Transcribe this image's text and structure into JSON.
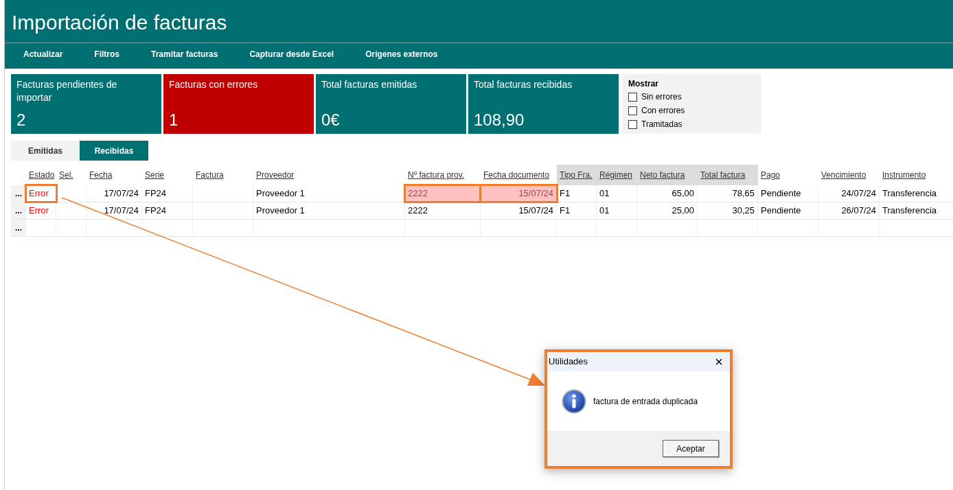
{
  "window": {
    "title": "Importación de facturas"
  },
  "menu": [
    "Actualizar",
    "Filtros",
    "Tramitar facturas",
    "Capturar desde Excel",
    "Orígenes externos"
  ],
  "stats": [
    {
      "label": "Facturas pendientes de importar",
      "value": "2",
      "kind": "normal"
    },
    {
      "label": "Facturas con errores",
      "value": "1",
      "kind": "alert"
    },
    {
      "label": "Total facturas emitidas",
      "value": "0€",
      "kind": "normal"
    },
    {
      "label": "Total facturas recibidas",
      "value": "108,90",
      "kind": "normal"
    }
  ],
  "filters": {
    "title": "Mostrar",
    "options": [
      {
        "label": "Sin errores",
        "checked": false
      },
      {
        "label": "Con errores",
        "checked": false
      },
      {
        "label": "Tramitadas",
        "checked": false
      }
    ]
  },
  "tabs": [
    {
      "label": "Emitidas",
      "selected": false
    },
    {
      "label": "Recibidas",
      "selected": true
    }
  ],
  "table": {
    "columns": [
      {
        "label": "Estado",
        "shaded": false
      },
      {
        "label": "Sel.",
        "shaded": false
      },
      {
        "label": "Fecha",
        "shaded": false
      },
      {
        "label": "Serie",
        "shaded": false
      },
      {
        "label": "Factura",
        "shaded": false
      },
      {
        "label": "Proveedor",
        "shaded": false
      },
      {
        "label": "Nº factura prov.",
        "shaded": false
      },
      {
        "label": "Fecha documento",
        "shaded": false
      },
      {
        "label": "Tipo Fra.",
        "shaded": true
      },
      {
        "label": "Régimen",
        "shaded": true
      },
      {
        "label": "Neto factura",
        "shaded": true
      },
      {
        "label": "Total factura",
        "shaded": true
      },
      {
        "label": "Pago",
        "shaded": false
      },
      {
        "label": "Vencimiento",
        "shaded": false
      },
      {
        "label": "Instrumento",
        "shaded": false
      }
    ],
    "rows": [
      {
        "handle": "...",
        "cells": [
          {
            "text": "Error",
            "error": true,
            "marked": true,
            "highlighted": false
          },
          {
            "text": "",
            "marked": false,
            "highlighted": false
          },
          {
            "text": "17/07/24",
            "marked": false,
            "highlighted": false
          },
          {
            "text": "FP24",
            "marked": false,
            "highlighted": false
          },
          {
            "text": "",
            "marked": false,
            "highlighted": false
          },
          {
            "text": "Proveedor 1",
            "marked": false,
            "highlighted": false
          },
          {
            "text": "2222",
            "marked": true,
            "highlighted": true
          },
          {
            "text": "15/07/24",
            "marked": true,
            "highlighted": true
          },
          {
            "text": "F1",
            "marked": false,
            "highlighted": false
          },
          {
            "text": "01",
            "marked": false,
            "highlighted": false
          },
          {
            "text": "65,00",
            "marked": false,
            "highlighted": false
          },
          {
            "text": "78,65",
            "marked": false,
            "highlighted": false
          },
          {
            "text": "Pendiente",
            "marked": false,
            "highlighted": false
          },
          {
            "text": "24/07/24",
            "marked": false,
            "highlighted": false
          },
          {
            "text": "Transferencia",
            "marked": false,
            "highlighted": false
          }
        ]
      },
      {
        "handle": "...",
        "cells": [
          {
            "text": "Error",
            "error": true,
            "marked": false,
            "highlighted": false
          },
          {
            "text": "",
            "marked": false,
            "highlighted": false
          },
          {
            "text": "17/07/24",
            "marked": false,
            "highlighted": false
          },
          {
            "text": "FP24",
            "marked": false,
            "highlighted": false
          },
          {
            "text": "",
            "marked": false,
            "highlighted": false
          },
          {
            "text": "Proveedor 1",
            "marked": false,
            "highlighted": false
          },
          {
            "text": "2222",
            "marked": false,
            "highlighted": false
          },
          {
            "text": "15/07/24",
            "marked": false,
            "highlighted": false
          },
          {
            "text": "F1",
            "marked": false,
            "highlighted": false
          },
          {
            "text": "01",
            "marked": false,
            "highlighted": false
          },
          {
            "text": "25,00",
            "marked": false,
            "highlighted": false
          },
          {
            "text": "30,25",
            "marked": false,
            "highlighted": false
          },
          {
            "text": "Pendiente",
            "marked": false,
            "highlighted": false
          },
          {
            "text": "26/07/24",
            "marked": false,
            "highlighted": false
          },
          {
            "text": "Transferencia",
            "marked": false,
            "highlighted": false
          }
        ]
      },
      {
        "handle": "...",
        "cells": []
      }
    ]
  },
  "dialog": {
    "title": "Utilidades",
    "close": "×",
    "message": "factura de entrada duplicada",
    "button": "Aceptar",
    "marked": true,
    "arrow": true
  }
}
